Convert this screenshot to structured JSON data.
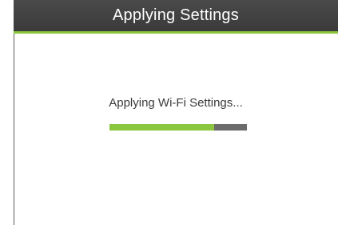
{
  "dialog": {
    "title": "Applying Settings",
    "status_text": "Applying Wi-Fi Settings...",
    "progress_fraction": 0.76,
    "colors": {
      "accent": "#8bc63f",
      "titlebar": "#404040",
      "track": "#6b6b6b"
    }
  }
}
